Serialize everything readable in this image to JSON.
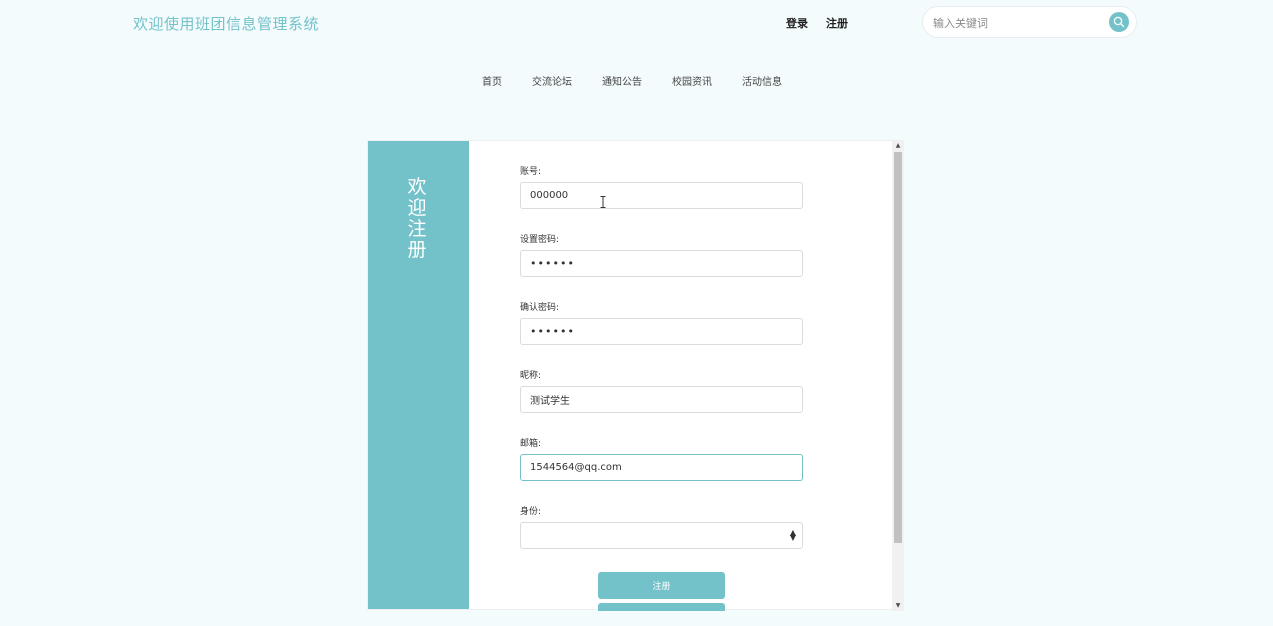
{
  "header": {
    "site_title": "欢迎使用班团信息管理系统",
    "login_label": "登录",
    "register_label": "注册",
    "search_placeholder": "输入关键词"
  },
  "nav": {
    "items": [
      "首页",
      "交流论坛",
      "通知公告",
      "校园资讯",
      "活动信息"
    ]
  },
  "panel": {
    "welcome_text": "欢迎注册",
    "fields": {
      "account": {
        "label": "账号:",
        "value": "000000"
      },
      "password": {
        "label": "设置密码:",
        "value": "••••••"
      },
      "confirm_password": {
        "label": "确认密码:",
        "value": "••••••"
      },
      "nickname": {
        "label": "昵称:",
        "value": "测试学生"
      },
      "email": {
        "label": "邮箱:",
        "value": "1544564@qq.com"
      },
      "identity": {
        "label": "身份:",
        "value": ""
      }
    },
    "submit_label": "注册"
  },
  "colors": {
    "accent": "#74c2c9",
    "background": "#f3fbfd"
  }
}
